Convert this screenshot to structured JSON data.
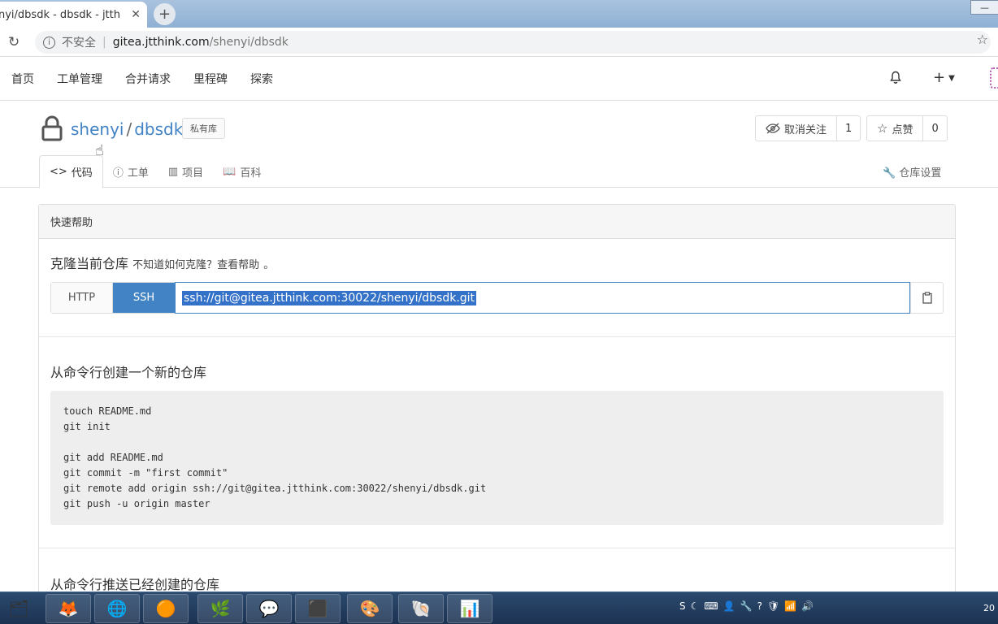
{
  "browser": {
    "tab_title": "nyi/dbsdk - dbsdk - jtthink",
    "insecure_label": "不安全",
    "url_host": "gitea.jtthink.com",
    "url_path": "/shenyi/dbsdk"
  },
  "nav": {
    "items": [
      "首页",
      "工单管理",
      "合并请求",
      "里程碑",
      "探索"
    ]
  },
  "repo": {
    "owner": "shenyi",
    "name": "dbsdk",
    "private_label": "私有库",
    "watch_label": "取消关注",
    "watch_count": "1",
    "star_label": "点赞",
    "star_count": "0",
    "tabs": [
      "代码",
      "工单",
      "项目",
      "百科"
    ],
    "settings_label": "仓库设置"
  },
  "quickstart": {
    "header": "快速帮助",
    "clone_title": "克隆当前仓库",
    "clone_hint": "不知道如何克隆？查看",
    "clone_help_link": "帮助",
    "clone_hint_end": "。",
    "proto_http": "HTTP",
    "proto_ssh": "SSH",
    "clone_url": "ssh://git@gitea.jtthink.com:30022/shenyi/dbsdk.git",
    "new_repo_title": "从命令行创建一个新的仓库",
    "new_repo_code": "touch README.md\ngit init\n\ngit add README.md\ngit commit -m \"first commit\"\ngit remote add origin ssh://git@gitea.jtthink.com:30022/shenyi/dbsdk.git\ngit push -u origin master",
    "push_existing_title": "从命令行推送已经创建的仓库"
  },
  "taskbar": {
    "clock": "20"
  }
}
